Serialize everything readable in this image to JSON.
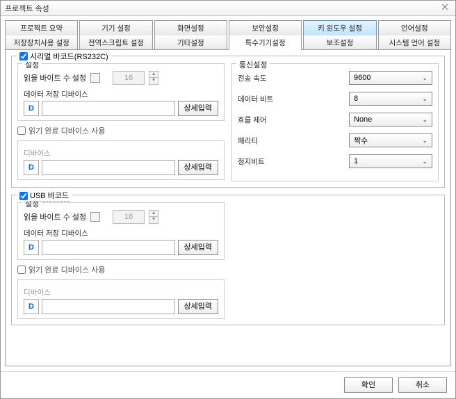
{
  "window": {
    "title": "프로젝트 속성",
    "close_icon": "⨉"
  },
  "tabs_row1": [
    "프로젝트 요약",
    "기기 설정",
    "화면설정",
    "보안설정",
    "키 윈도우 설정",
    "언어설정"
  ],
  "tabs_row2": [
    "저장장치사용 설정",
    "전역스크립트 설정",
    "기타설정",
    "특수기기설정",
    "보조설정",
    "시스템 언어 설정"
  ],
  "active_tab_row1_index": 4,
  "selected_tab_row2_index": 3,
  "serial": {
    "title": "시리얼 바코드(RS232C)",
    "checked": true,
    "settings_label": "설정",
    "byte_label": "읽을 바이트 수 설정",
    "byte_value": "16",
    "data_device_label": "데이터 저장 디바이스",
    "prefix": "D",
    "detail_btn": "상세입력",
    "use_complete_label": "읽기 완료 디바이스 사용",
    "device_label": "디바이스",
    "comm_label": "통신설정",
    "comm": {
      "baud_label": "전송 속도",
      "baud": "9600",
      "databit_label": "데이터 비트",
      "databit": "8",
      "flow_label": "흐름 제어",
      "flow": "None",
      "parity_label": "패리티",
      "parity": "짝수",
      "stopbit_label": "정지비트",
      "stopbit": "1"
    }
  },
  "usb": {
    "title": "USB 바코드",
    "checked": true,
    "settings_label": "설정",
    "byte_label": "읽을 바이트 수 설정",
    "byte_value": "16",
    "data_device_label": "데이터 저장 디바이스",
    "prefix": "D",
    "detail_btn": "상세입력",
    "use_complete_label": "읽기 완료 디바이스 사용",
    "device_label": "디바이스"
  },
  "footer": {
    "ok": "확인",
    "cancel": "취소"
  }
}
